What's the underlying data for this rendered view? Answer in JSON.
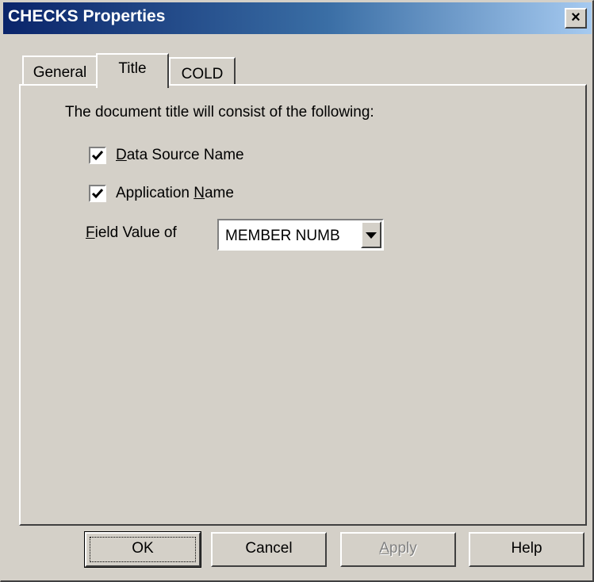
{
  "window": {
    "title": "CHECKS Properties",
    "close_glyph": "×"
  },
  "tabs": [
    {
      "label": "General",
      "active": false
    },
    {
      "label": "Title",
      "active": true
    },
    {
      "label": "COLD",
      "active": false
    }
  ],
  "panel": {
    "heading": "The document title will consist of the following:",
    "checkboxes": [
      {
        "mnemonic": "D",
        "rest": "ata Source Name",
        "checked": true
      },
      {
        "pre": "Application ",
        "mnemonic": "N",
        "rest": "ame",
        "checked": true
      }
    ],
    "field": {
      "label_mnemonic": "F",
      "label_rest": "ield Value of",
      "value": "MEMBER NUMB"
    }
  },
  "buttons": {
    "ok": "OK",
    "cancel": "Cancel",
    "apply_mnemonic": "A",
    "apply_rest": "pply",
    "help": "Help"
  },
  "colors": {
    "face": "#d4d0c8",
    "title_start": "#0a246a",
    "title_end": "#a6caf0"
  },
  "icons": {
    "close": "close-icon",
    "checkmark": "checkmark-icon",
    "dropdown": "chevron-down-icon"
  }
}
